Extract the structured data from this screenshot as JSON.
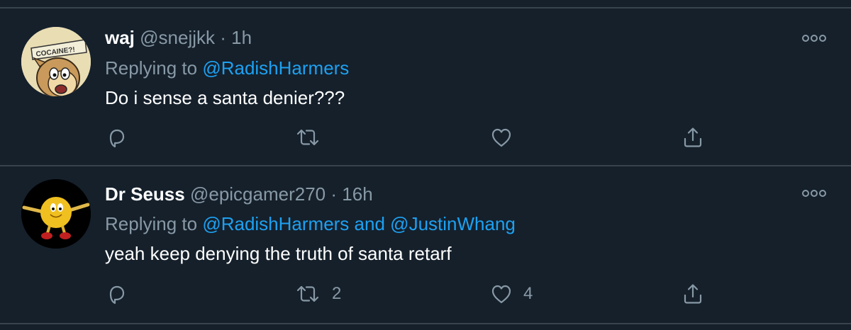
{
  "tweets": [
    {
      "display_name": "waj",
      "handle": "@snejjkk",
      "separator": "·",
      "time": "1h",
      "replying_prefix": "Replying to",
      "mention1": "@RadishHarmers",
      "mention_joiner": "",
      "mention2": "",
      "text": "Do i sense a santa denier???",
      "avatar_text": "COCAINE?!",
      "retweet_count": "",
      "like_count": ""
    },
    {
      "display_name": "Dr Seuss",
      "handle": "@epicgamer270",
      "separator": "·",
      "time": "16h",
      "replying_prefix": "Replying to",
      "mention1": "@RadishHarmers",
      "mention_joiner": "and",
      "mention2": "@JustinWhang",
      "text": "yeah keep denying the truth of santa retarf",
      "avatar_text": "",
      "retweet_count": "2",
      "like_count": "4"
    }
  ],
  "icons": {
    "reply": "reply-icon",
    "retweet": "retweet-icon",
    "like": "heart-icon",
    "share": "share-icon",
    "more": "more-options-icon"
  },
  "colors": {
    "background": "#15202b",
    "divider": "#38444d",
    "primary_text": "#ffffff",
    "secondary_text": "#8899a6",
    "link": "#1da1f2"
  }
}
